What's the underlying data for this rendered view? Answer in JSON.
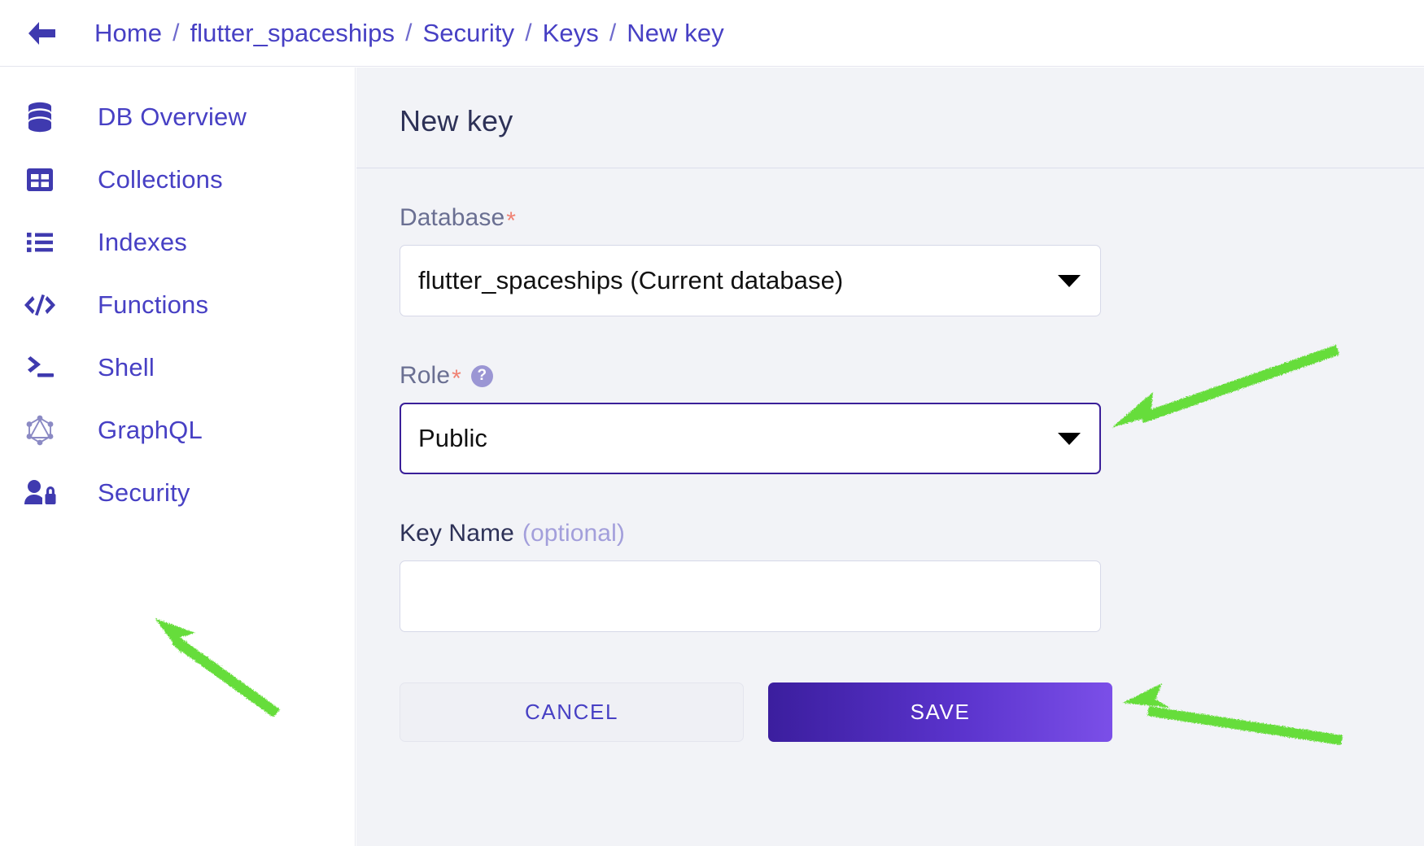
{
  "topbar": {
    "back_icon": "arrow-left-icon",
    "breadcrumb": [
      {
        "label": "Home"
      },
      {
        "label": "flutter_spaceships"
      },
      {
        "label": "Security"
      },
      {
        "label": "Keys"
      },
      {
        "label": "New key"
      }
    ],
    "separator": "/"
  },
  "sidebar": {
    "items": [
      {
        "label": "DB Overview",
        "icon": "database-icon"
      },
      {
        "label": "Collections",
        "icon": "grid-table-icon"
      },
      {
        "label": "Indexes",
        "icon": "list-bullets-icon"
      },
      {
        "label": "Functions",
        "icon": "code-brackets-icon"
      },
      {
        "label": "Shell",
        "icon": "terminal-prompt-icon"
      },
      {
        "label": "GraphQL",
        "icon": "graphql-hexagon-icon"
      },
      {
        "label": "Security",
        "icon": "person-lock-icon"
      }
    ]
  },
  "main": {
    "title": "New key",
    "fields": {
      "database": {
        "label": "Database",
        "required_marker": "*",
        "value": "flutter_spaceships (Current database)",
        "caret_icon": "chevron-down-icon"
      },
      "role": {
        "label": "Role",
        "required_marker": "*",
        "help_icon": "help-question-icon",
        "help_glyph": "?",
        "value": "Public",
        "caret_icon": "chevron-down-icon",
        "focused": true
      },
      "key_name": {
        "label": "Key Name",
        "optional_text": "(optional)",
        "value": "",
        "placeholder": ""
      }
    },
    "buttons": {
      "cancel_label": "CANCEL",
      "save_label": "SAVE"
    }
  },
  "annotations": [
    {
      "name": "arrow-to-role-select",
      "color": "#66dd3a"
    },
    {
      "name": "arrow-to-security-nav",
      "color": "#66dd3a"
    },
    {
      "name": "arrow-to-save-button",
      "color": "#66dd3a"
    }
  ],
  "colors": {
    "brand_purple": "#4740c4",
    "title_navy": "#2d3157",
    "accent_red": "#f08273",
    "content_bg": "#f2f3f7",
    "annotation_green": "#66dd3a",
    "save_gradient_start": "#3b1e9e",
    "save_gradient_end": "#7b4fe8"
  }
}
